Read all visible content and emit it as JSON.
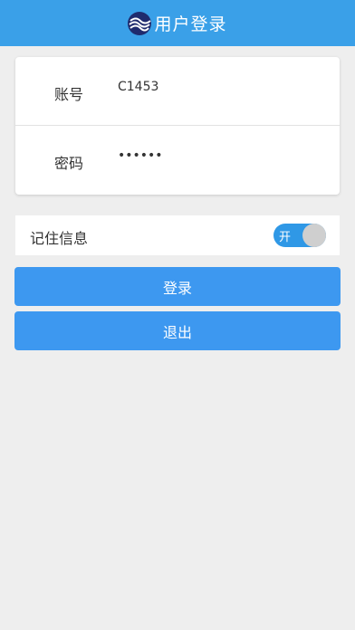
{
  "header": {
    "title": "用户登录",
    "logo_icon": "wave-logo-icon"
  },
  "form": {
    "account_label": "账号",
    "account_value": "C1453",
    "password_label": "密码",
    "password_value": "••••••"
  },
  "remember": {
    "label": "记住信息",
    "toggle_text": "开",
    "checked": true
  },
  "buttons": {
    "login": "登录",
    "exit": "退出"
  },
  "colors": {
    "header": "#3aa0e8",
    "button": "#3d98f0",
    "toggle_on": "#2f98e6",
    "background": "#eeeeee"
  }
}
